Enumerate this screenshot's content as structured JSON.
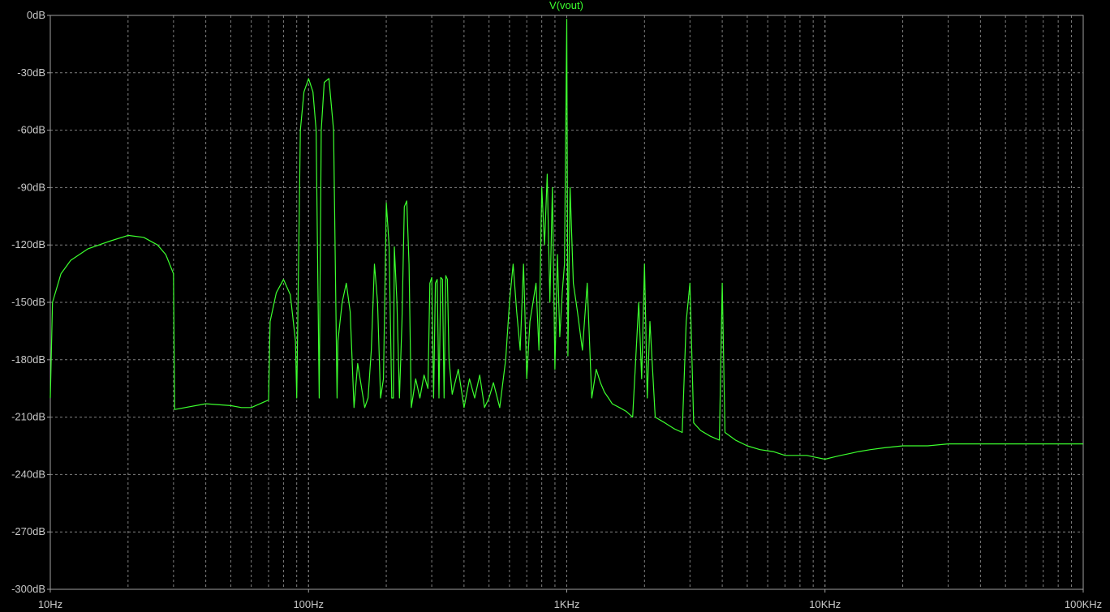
{
  "window": {
    "bg_color": "#000000",
    "grid_color": "#808080",
    "trace_color": "#3cff2e",
    "label_color": "#c8c8c8"
  },
  "chart_data": {
    "type": "line",
    "title": "V(vout)",
    "xlabel": "",
    "ylabel": "",
    "x_scale": "log",
    "xlim": [
      10,
      100000
    ],
    "ylim": [
      -300,
      0
    ],
    "grid": true,
    "x_ticks": [
      10,
      100,
      1000,
      10000,
      100000
    ],
    "x_tick_labels": [
      "10Hz",
      "100Hz",
      "1KHz",
      "10KHz",
      "100KHz"
    ],
    "y_ticks": [
      0,
      -30,
      -60,
      -90,
      -120,
      -150,
      -180,
      -210,
      -240,
      -270,
      -300
    ],
    "y_tick_labels": [
      "0dB",
      "-30dB",
      "-60dB",
      "-90dB",
      "-120dB",
      "-150dB",
      "-180dB",
      "-210dB",
      "-240dB",
      "-270dB",
      "-300dB"
    ],
    "series": [
      {
        "color": "#3cff2e",
        "x": [
          10,
          10.2,
          11,
          12,
          14,
          17,
          20,
          23,
          26,
          28,
          30,
          30.3,
          40,
          50,
          55,
          60,
          70,
          71,
          75,
          80,
          85,
          89,
          90,
          93,
          96,
          100,
          104,
          107,
          110,
          112,
          115,
          120,
          125,
          129,
          130,
          135,
          140,
          145,
          150,
          155,
          165,
          170,
          175,
          180,
          185,
          190,
          195,
          200,
          205,
          210,
          213,
          215,
          220,
          225,
          230,
          235,
          240,
          245,
          250,
          260,
          270,
          280,
          290,
          295,
          300,
          305,
          310,
          315,
          320,
          325,
          330,
          335,
          340,
          345,
          350,
          360,
          380,
          400,
          420,
          440,
          460,
          480,
          500,
          520,
          550,
          580,
          600,
          620,
          640,
          660,
          680,
          700,
          720,
          740,
          760,
          780,
          800,
          820,
          840,
          860,
          880,
          900,
          920,
          940,
          960,
          980,
          1000,
          1010,
          1030,
          1060,
          1100,
          1150,
          1200,
          1250,
          1300,
          1350,
          1400,
          1450,
          1500,
          1600,
          1700,
          1800,
          1900,
          1950,
          2000,
          2050,
          2100,
          2200,
          2400,
          2600,
          2800,
          2900,
          3000,
          3100,
          3300,
          3600,
          3900,
          4000,
          4100,
          4500,
          5000,
          5600,
          6300,
          7000,
          7800,
          8500,
          9200,
          10000,
          10700,
          11500,
          12500,
          13500,
          15000,
          17000,
          20000,
          25000,
          30000,
          40000,
          50000,
          70000,
          100000
        ],
        "y": [
          -200,
          -150,
          -135,
          -128,
          -122,
          -118,
          -115,
          -116,
          -120,
          -125,
          -135,
          -206,
          -203,
          -204,
          -205,
          -205,
          -201,
          -160,
          -145,
          -138,
          -146,
          -170,
          -200,
          -60,
          -40,
          -33,
          -40,
          -60,
          -200,
          -60,
          -35,
          -33,
          -60,
          -200,
          -170,
          -150,
          -140,
          -155,
          -205,
          -182,
          -205,
          -200,
          -175,
          -130,
          -150,
          -200,
          -190,
          -98,
          -120,
          -200,
          -200,
          -121,
          -150,
          -200,
          -160,
          -100,
          -97,
          -130,
          -205,
          -190,
          -200,
          -188,
          -195,
          -140,
          -137,
          -200,
          -140,
          -138,
          -200,
          -137,
          -138,
          -200,
          -136,
          -138,
          -180,
          -198,
          -185,
          -205,
          -190,
          -200,
          -188,
          -205,
          -200,
          -192,
          -205,
          -180,
          -150,
          -130,
          -155,
          -175,
          -130,
          -190,
          -160,
          -150,
          -140,
          -175,
          -90,
          -120,
          -83,
          -150,
          -90,
          -185,
          -125,
          -168,
          -145,
          -130,
          -2,
          -178,
          -90,
          -140,
          -155,
          -175,
          -140,
          -200,
          -185,
          -192,
          -197,
          -200,
          -203,
          -205,
          -207,
          -210,
          -150,
          -190,
          -130,
          -200,
          -160,
          -210,
          -213,
          -216,
          -218,
          -160,
          -140,
          -213,
          -217,
          -220,
          -222,
          -140,
          -218,
          -222,
          -225,
          -227,
          -228,
          -230,
          -230,
          -230,
          -231,
          -232,
          -231,
          -230,
          -229,
          -228,
          -227,
          -226,
          -225,
          -225,
          -224,
          -224,
          -224,
          -224,
          -224
        ]
      }
    ]
  }
}
